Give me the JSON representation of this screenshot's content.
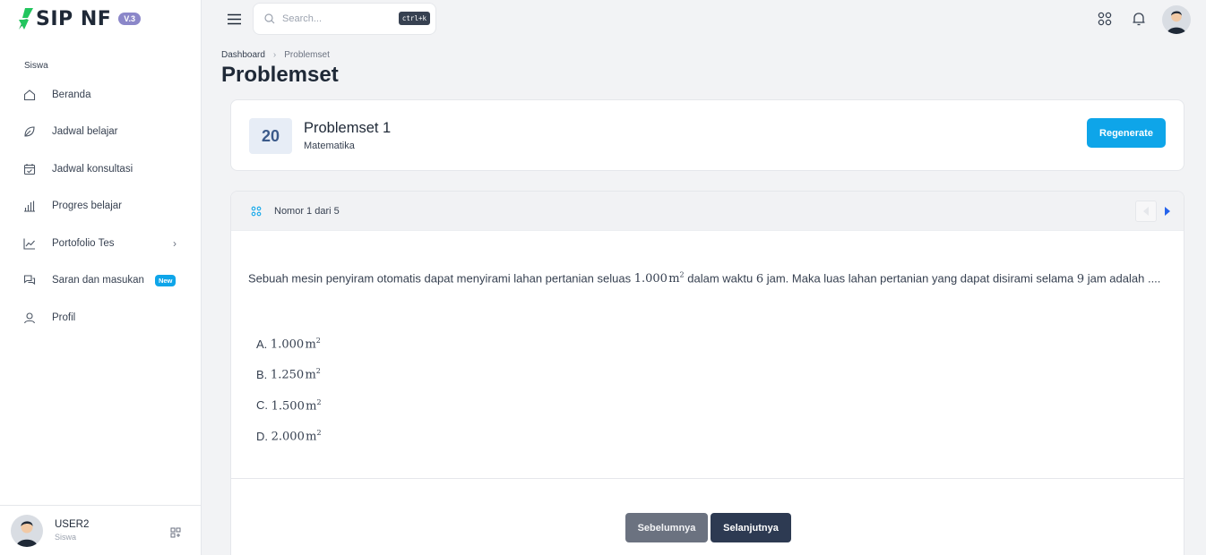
{
  "app": {
    "name": "SIP NF",
    "version": "V.3"
  },
  "sidebar": {
    "section_label": "Siswa",
    "items": [
      {
        "label": "Beranda",
        "icon": "home-icon"
      },
      {
        "label": "Jadwal belajar",
        "icon": "leaf-icon"
      },
      {
        "label": "Jadwal konsultasi",
        "icon": "calendar-check-icon"
      },
      {
        "label": "Progres belajar",
        "icon": "bar-chart-icon"
      },
      {
        "label": "Portofolio Tes",
        "icon": "line-chart-icon",
        "chevron": "›"
      },
      {
        "label": "Saran dan masukan",
        "icon": "chat-bubbles-icon",
        "badge": "New"
      },
      {
        "label": "Profil",
        "icon": "user-icon"
      }
    ],
    "user": {
      "name": "USER2",
      "role": "Siswa"
    }
  },
  "topbar": {
    "search_placeholder": "Search...",
    "search_shortcut": "ctrl+k"
  },
  "breadcrumb": {
    "root": "Dashboard",
    "separator": "›",
    "current": "Problemset"
  },
  "page_title": "Problemset",
  "problemset": {
    "count": "20",
    "title": "Problemset 1",
    "subject": "Matematika",
    "regenerate_label": "Regenerate"
  },
  "question": {
    "position_label": "Nomor 1 dari 5",
    "text_part1": "Sebuah mesin penyiram otomatis dapat menyirami lahan pertanian seluas ",
    "area_value": "1.000",
    "unit": "m",
    "unit_power": "2",
    "text_part2": " dalam waktu ",
    "hours_value": "6",
    "text_part3": " jam. Maka luas lahan pertanian yang dapat disirami selama ",
    "target_hours": "9",
    "text_part4": " jam adalah ....",
    "options": [
      {
        "letter": "A.",
        "value": "1.000"
      },
      {
        "letter": "B.",
        "value": "1.250"
      },
      {
        "letter": "C.",
        "value": "1.500"
      },
      {
        "letter": "D.",
        "value": "2.000"
      }
    ],
    "prev_label": "Sebelumnya",
    "next_label": "Selanjutnya"
  },
  "colors": {
    "accent": "#0ea5e9",
    "logo_green": "#22c55e",
    "dark_button": "#2d3a52",
    "gray_button": "#6b7280",
    "count_bg": "#e7edf6",
    "version_badge": "#8b87c9"
  }
}
